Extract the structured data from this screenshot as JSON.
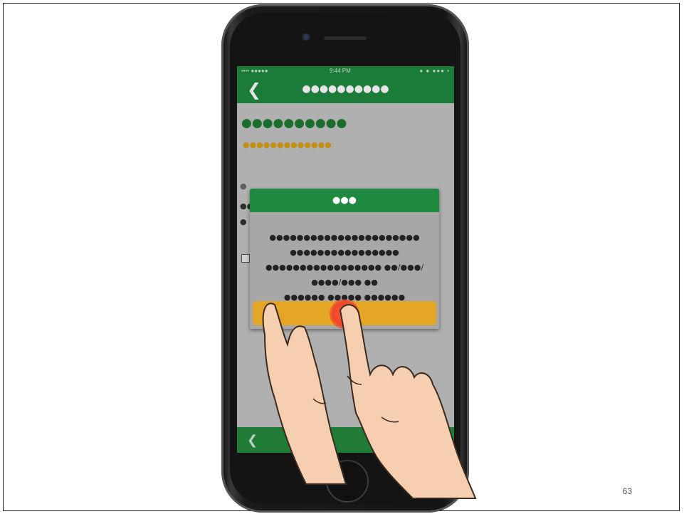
{
  "slide": {
    "page_number": "63"
  },
  "status_bar": {
    "carrier": "•••• ●●●●●",
    "time": "9:44 PM",
    "indicators": "● ● ●●● ▪"
  },
  "nav": {
    "back_icon": "chevron-left-icon",
    "back_glyph": "❮",
    "title": "●●●●●●●●●●"
  },
  "content": {
    "title": "●●●●●●●●●●",
    "subtitle": "●●●●●●●●●●●●●:",
    "label": "●",
    "text_1": "●●",
    "text_2": "●"
  },
  "bottom_bar": {
    "back_glyph": "❮"
  },
  "dialog": {
    "title": "●●●",
    "body_line_1": "●●●●●●●●●●●●●●●●●●●●●● ●●●●●●●●●●●●●●●●",
    "body_line_2": "●●●●●●●●●●●●●●●●● ●●/●●●/●●●●/●●● ●●",
    "body_line_3": "●●●●●● ●●●●● ●●●●●●",
    "ok_label": ""
  },
  "colors": {
    "accent_green": "#1f8a3f",
    "button_orange": "#e5a526",
    "title_gold": "#d7a21c",
    "tap_red": "#f0462a"
  }
}
